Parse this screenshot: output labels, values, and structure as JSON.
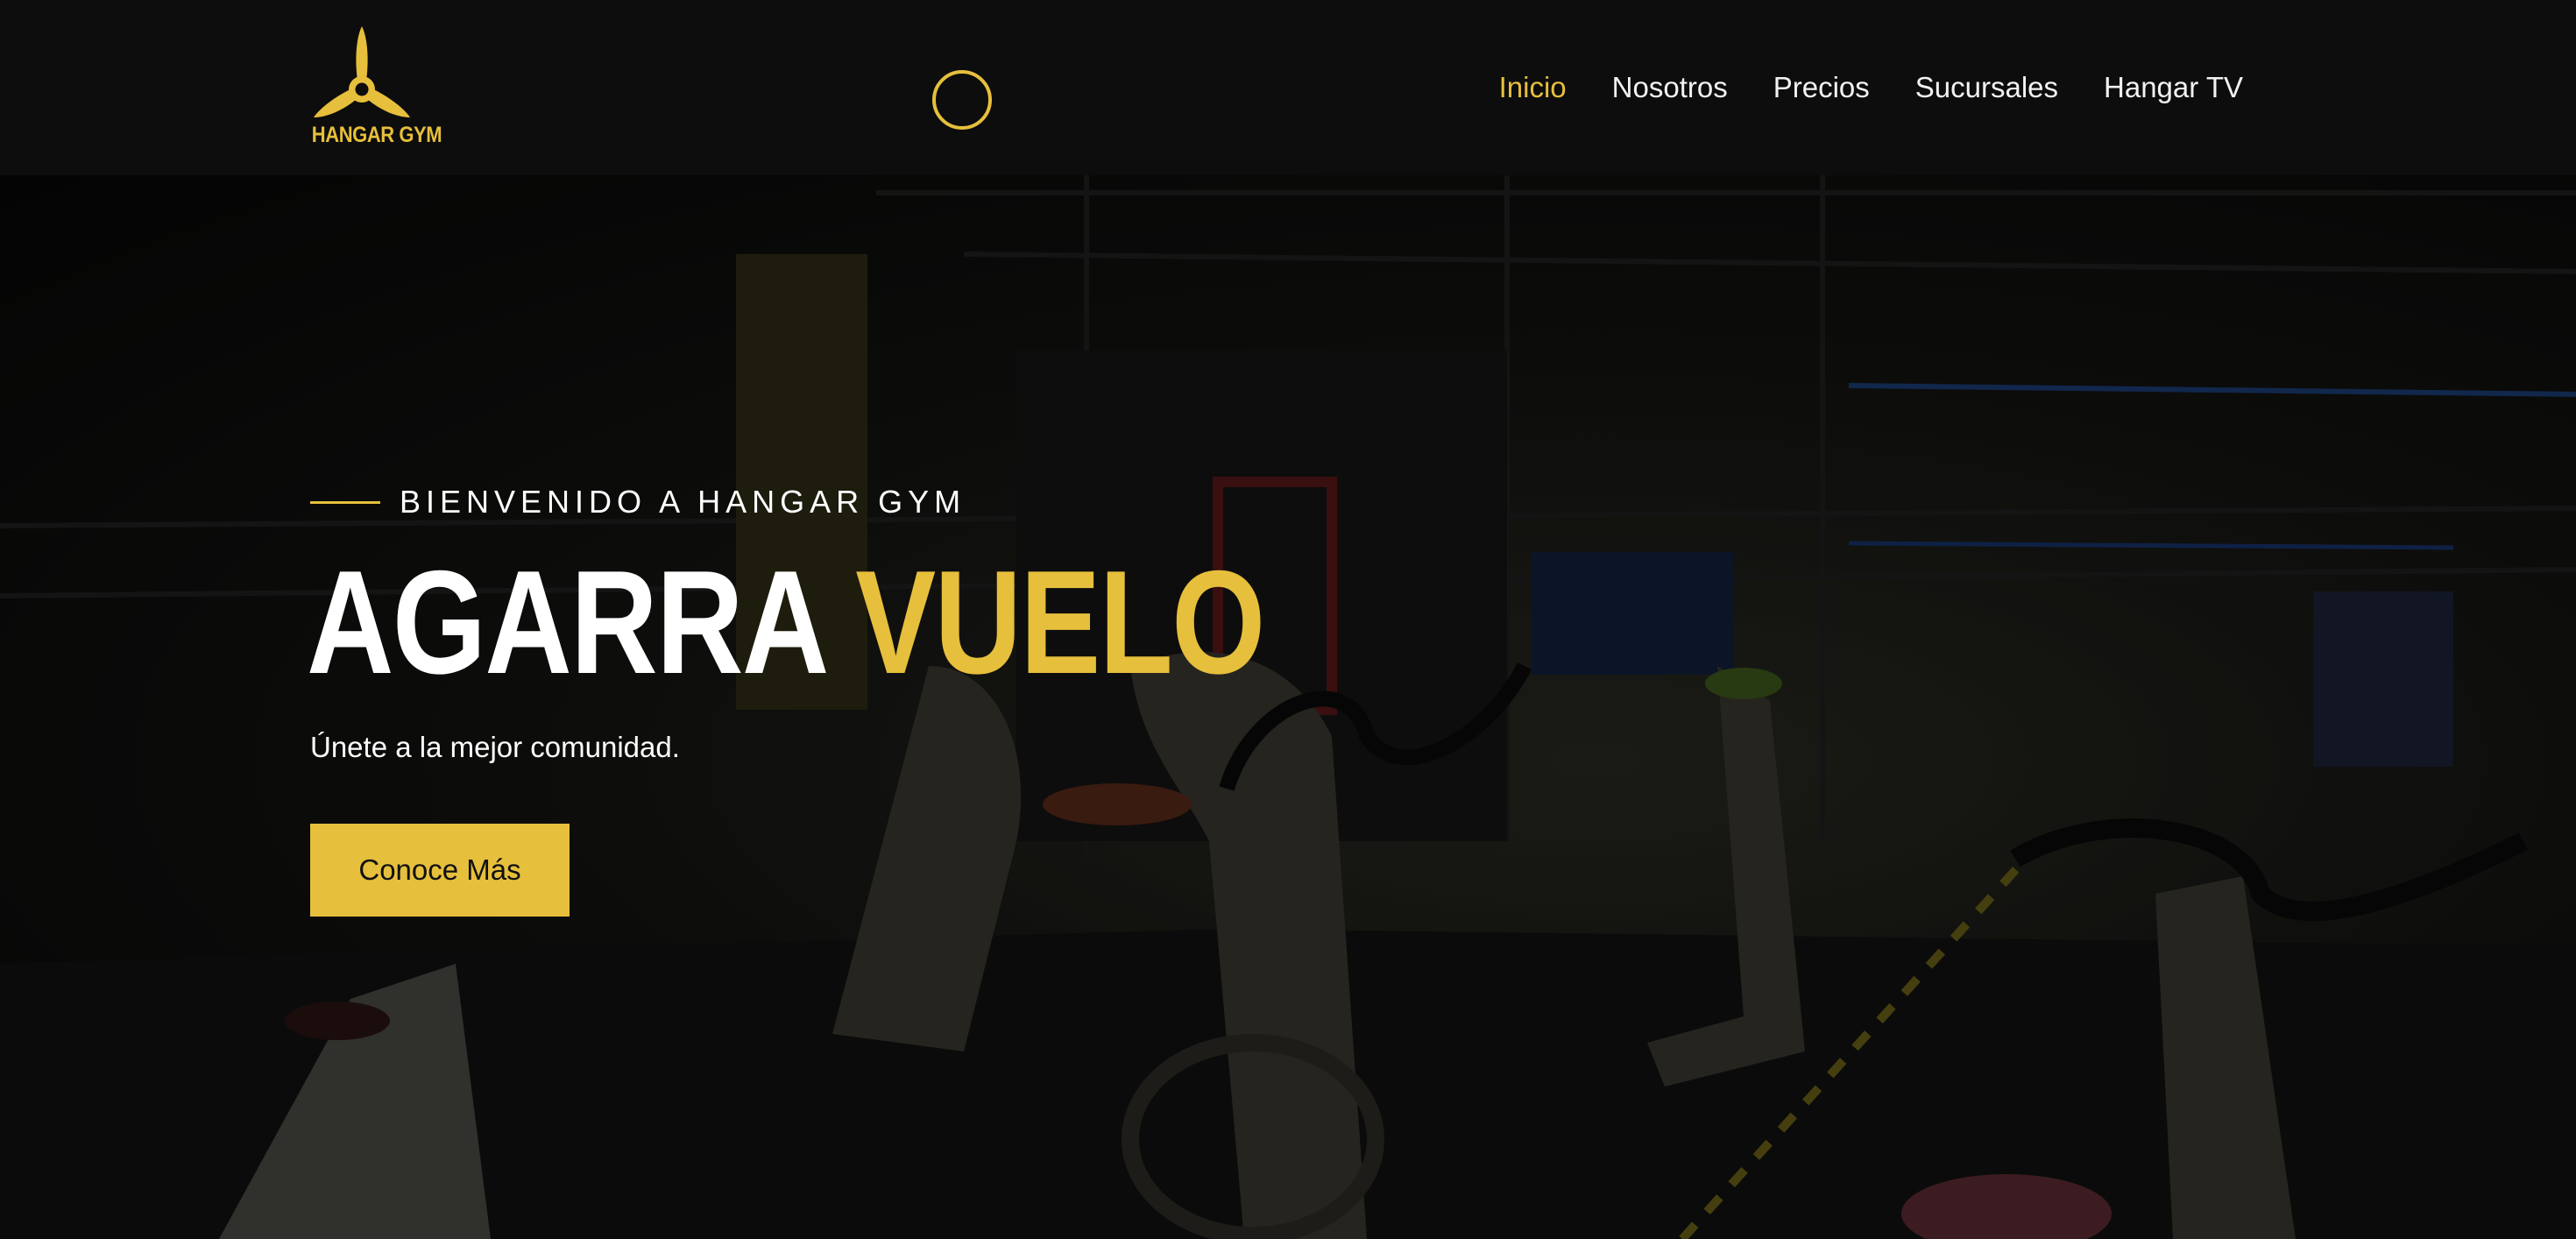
{
  "brand": {
    "logo_text": "HANGAR GYM",
    "accent_color": "#e6bf3c",
    "logo_icon": "propeller-icon"
  },
  "header": {
    "loader_icon": "loading-ring-icon"
  },
  "nav": {
    "items": [
      {
        "label": "Inicio",
        "active": true
      },
      {
        "label": "Nosotros",
        "active": false
      },
      {
        "label": "Precios",
        "active": false
      },
      {
        "label": "Sucursales",
        "active": false
      },
      {
        "label": "Hangar TV",
        "active": false
      }
    ]
  },
  "hero": {
    "eyebrow": "BIENVENIDO A HANGAR GYM",
    "headline_main": "AGARRA ",
    "headline_accent": "VUELO",
    "subtitle": "Únete a la mejor comunidad.",
    "cta_label": "Conoce Más"
  }
}
